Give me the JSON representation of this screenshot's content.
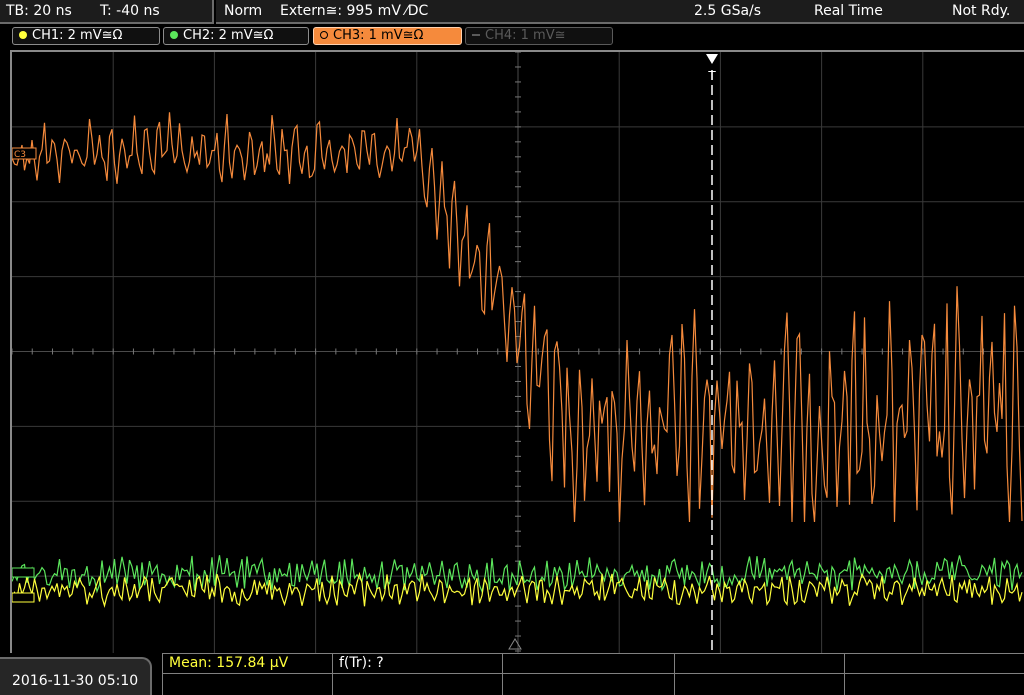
{
  "header": {
    "timebase": "TB: 20 ns",
    "trigger_pos": "T: -40 ns",
    "trigger_mode": "Norm",
    "trigger_source": "Extern≅: 995 mV ⁄DC",
    "sample_rate": "2.5 GSa/s",
    "acq_mode": "Real Time",
    "status": "Not Rdy."
  },
  "channels": [
    {
      "label": "CH1: 2 mV≅Ω",
      "color": "#ffff3c",
      "state": "on"
    },
    {
      "label": "CH2: 2 mV≅Ω",
      "color": "#5ce65c",
      "state": "on"
    },
    {
      "label": "CH3: 1 mV≅Ω",
      "color": "#f58a3c",
      "state": "active"
    },
    {
      "label": "CH4: 1 mV≅",
      "color": "#5a5a5a",
      "state": "off"
    }
  ],
  "markers": {
    "ch3_label": "C3",
    "trigger_marker": "T"
  },
  "footer": {
    "datetime": "2016-11-30 05:10",
    "measurement1": "Mean: 157.84 µV",
    "measurement2": "f(Tr): ?"
  },
  "colors": {
    "ch1": "#ffff3c",
    "ch2": "#5ce65c",
    "ch3": "#f58a3c",
    "grid": "#3a3a3a"
  }
}
